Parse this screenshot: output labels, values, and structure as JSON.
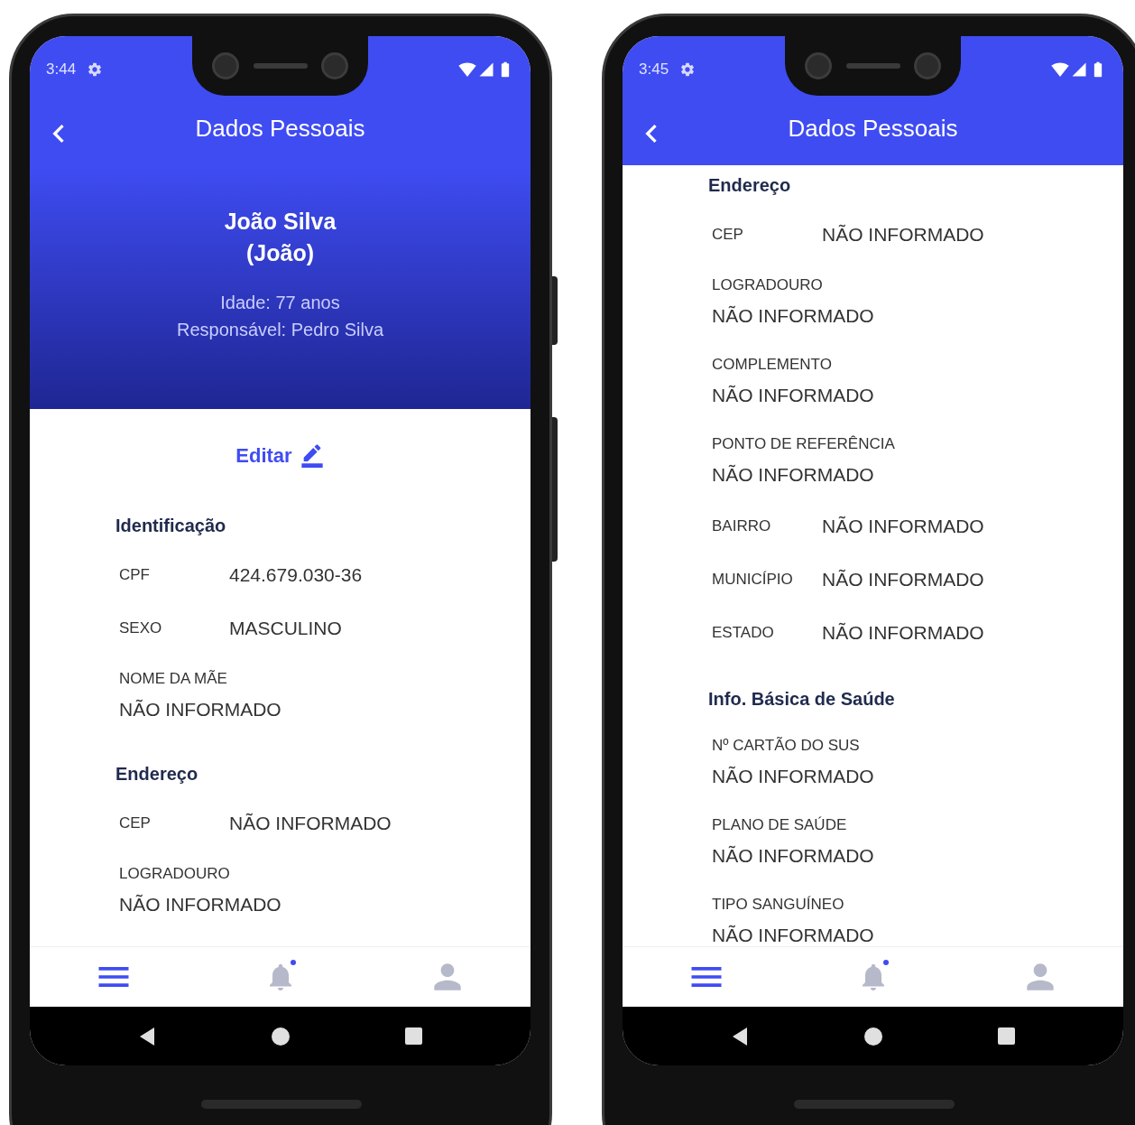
{
  "phones": [
    {
      "status_time": "3:44",
      "header_title": "Dados Pessoais",
      "profile": {
        "name": "João Silva",
        "nickname": "(João)",
        "lines": [
          "Idade: 77 anos",
          "Responsável: Pedro Silva"
        ]
      },
      "edit_link": "Editar",
      "sections": [
        {
          "title": "Identificação",
          "fields": [
            {
              "kind": "inline",
              "label": "CPF",
              "value": "424.679.030-36"
            },
            {
              "kind": "inline",
              "label": "SEXO",
              "value": "MASCULINO"
            },
            {
              "kind": "stacked",
              "label": "NOME DA MÃE",
              "value": "NÃO INFORMADO"
            }
          ]
        },
        {
          "title": "Endereço",
          "fields": [
            {
              "kind": "inline",
              "label": "CEP",
              "value": "NÃO INFORMADO"
            },
            {
              "kind": "stacked",
              "label": "LOGRADOURO",
              "value": "NÃO INFORMADO"
            }
          ]
        }
      ],
      "bottom_nav": [
        {
          "kind": "menu",
          "selected": true,
          "dot": false
        },
        {
          "kind": "bell",
          "selected": false,
          "dot": true
        },
        {
          "kind": "person",
          "selected": false,
          "dot": false
        }
      ]
    },
    {
      "status_time": "3:45",
      "header_title": "Dados Pessoais",
      "sections": [
        {
          "title": "Endereço",
          "fields": [
            {
              "kind": "inline",
              "label": "CEP",
              "value": "NÃO INFORMADO"
            },
            {
              "kind": "stacked",
              "label": "LOGRADOURO",
              "value": "NÃO INFORMADO"
            },
            {
              "kind": "stacked",
              "label": "COMPLEMENTO",
              "value": "NÃO INFORMADO"
            },
            {
              "kind": "stacked",
              "label": "PONTO DE REFERÊNCIA",
              "value": "NÃO INFORMADO"
            },
            {
              "kind": "inline",
              "label": "BAIRRO",
              "value": "NÃO INFORMADO"
            },
            {
              "kind": "inline",
              "label": "MUNICÍPIO",
              "value": "NÃO INFORMADO"
            },
            {
              "kind": "inline",
              "label": "ESTADO",
              "value": "NÃO INFORMADO"
            }
          ]
        },
        {
          "title": "Info. Básica de Saúde",
          "fields": [
            {
              "kind": "stacked",
              "label": "Nº CARTÃO DO SUS",
              "value": "NÃO INFORMADO"
            },
            {
              "kind": "stacked",
              "label": "PLANO DE SAÚDE",
              "value": "NÃO INFORMADO"
            },
            {
              "kind": "stacked",
              "label": "TIPO SANGUÍNEO",
              "value": "NÃO INFORMADO"
            }
          ]
        }
      ],
      "bottom_nav": [
        {
          "kind": "menu",
          "selected": true,
          "dot": false
        },
        {
          "kind": "bell",
          "selected": false,
          "dot": true
        },
        {
          "kind": "person",
          "selected": false,
          "dot": false
        }
      ]
    }
  ]
}
